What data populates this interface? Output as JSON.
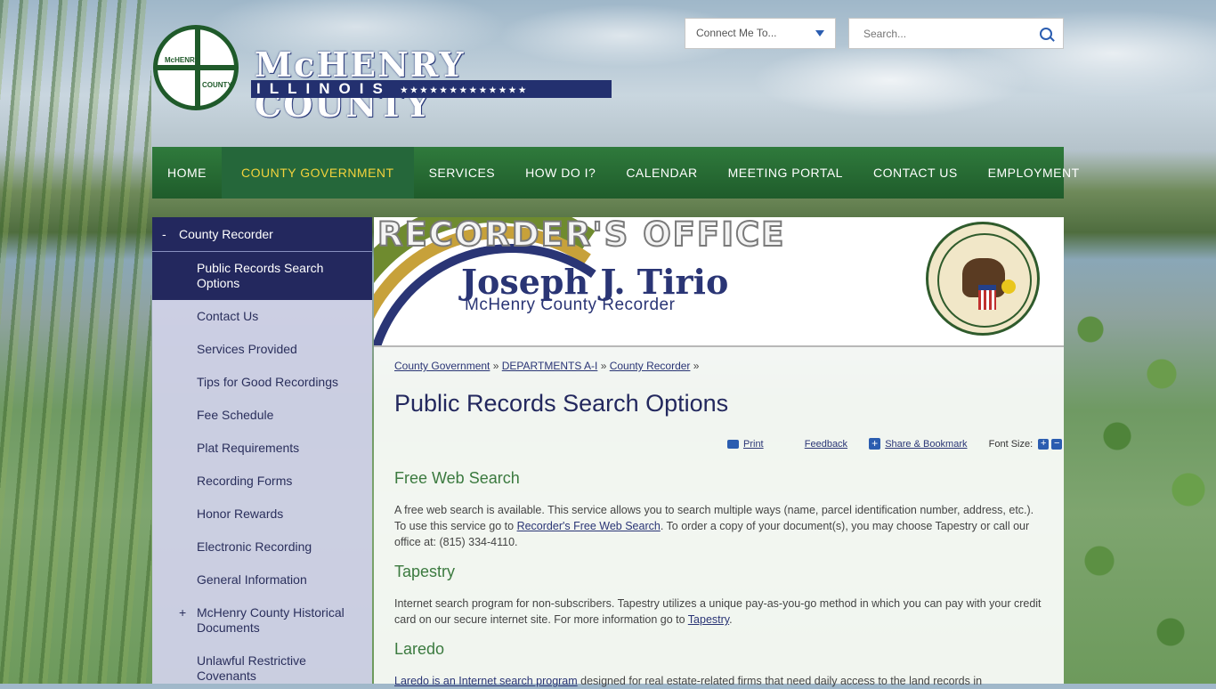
{
  "header": {
    "logo_abbrev_top": "McHENRY",
    "logo_abbrev_bottom": "COUNTY",
    "logo_name": "McHENRY COUNTY",
    "logo_state": "ILLINOIS",
    "logo_stars": "★★★★★★★★★★★★★",
    "connect_label": "Connect Me To...",
    "search_placeholder": "Search..."
  },
  "nav": {
    "items": [
      {
        "label": "HOME"
      },
      {
        "label": "COUNTY GOVERNMENT"
      },
      {
        "label": "SERVICES"
      },
      {
        "label": "HOW DO I?"
      },
      {
        "label": "CALENDAR"
      },
      {
        "label": "MEETING PORTAL"
      },
      {
        "label": "CONTACT US"
      },
      {
        "label": "EMPLOYMENT"
      }
    ]
  },
  "sidebar": {
    "heading": "County Recorder",
    "heading_marker": "-",
    "items": [
      {
        "label": "Public Records Search Options"
      },
      {
        "label": "Contact Us"
      },
      {
        "label": "Services Provided"
      },
      {
        "label": "Tips for Good Recordings"
      },
      {
        "label": "Fee Schedule"
      },
      {
        "label": "Plat Requirements"
      },
      {
        "label": "Recording Forms"
      },
      {
        "label": "Honor Rewards"
      },
      {
        "label": "Electronic Recording"
      },
      {
        "label": "General Information"
      },
      {
        "label": "McHenry County Historical Documents",
        "marker": "+"
      },
      {
        "label": "Unlawful Restrictive Covenants"
      }
    ]
  },
  "banner": {
    "title": "RECORDER'S OFFICE",
    "name": "Joseph J. Tirio",
    "role": "McHenry County Recorder"
  },
  "breadcrumb": {
    "items": [
      "County Government",
      "DEPARTMENTS A-I",
      "County Recorder"
    ],
    "separator": "»"
  },
  "page": {
    "title": "Public Records Search Options",
    "tools": {
      "print": "Print",
      "feedback": "Feedback",
      "share": "Share & Bookmark",
      "font_size": "Font Size:"
    },
    "sections": [
      {
        "heading": "Free Web Search",
        "text_before": "A free web search is available. This service allows you to search multiple ways (name, parcel identification number, address, etc.). To use this service go to ",
        "link": "Recorder's Free Web Search",
        "text_after": ". To order a copy of your document(s), you may choose Tapestry or call our office at: (815) 334-4110."
      },
      {
        "heading": "Tapestry",
        "text_before": "Internet search program for non-subscribers. Tapestry utilizes a unique pay-as-you-go method in which you can pay with your credit card on our secure internet site. For more information go to ",
        "link": "Tapestry",
        "text_after": "."
      },
      {
        "heading": "Laredo",
        "link": "Laredo is an Internet search program",
        "text_after": " designed for real estate-related firms that need daily access to the land records in"
      }
    ]
  }
}
